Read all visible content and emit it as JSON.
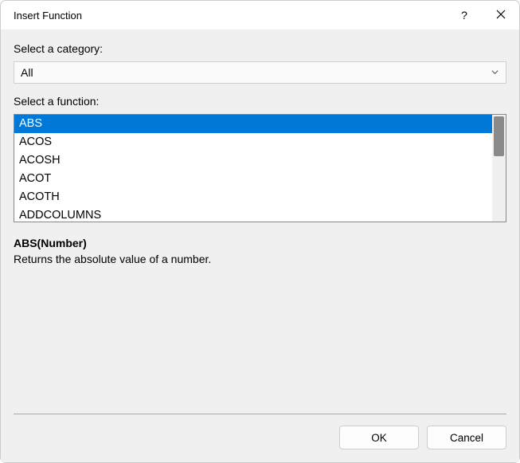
{
  "titlebar": {
    "title": "Insert Function",
    "help_label": "?"
  },
  "category": {
    "label": "Select a category:",
    "selected": "All"
  },
  "functions": {
    "label": "Select a function:",
    "items": [
      "ABS",
      "ACOS",
      "ACOSH",
      "ACOT",
      "ACOTH",
      "ADDCOLUMNS"
    ],
    "selected_index": 0
  },
  "description": {
    "signature": "ABS(Number)",
    "text": "Returns the absolute value of a number."
  },
  "buttons": {
    "ok": "OK",
    "cancel": "Cancel"
  }
}
